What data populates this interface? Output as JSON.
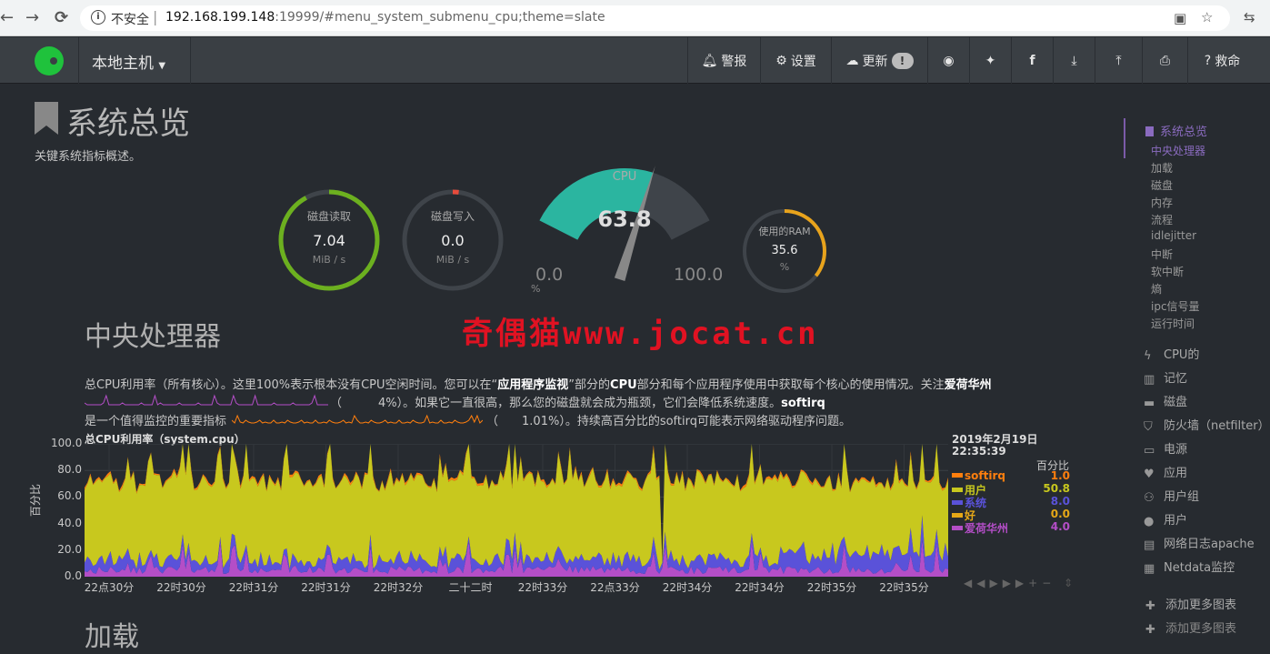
{
  "browser": {
    "insecure_label": "不安全",
    "url_host": "192.168.199.148",
    "url_rest": ":19999/#menu_system_submenu_cpu;theme=slate",
    "back": "←",
    "forward": "→",
    "reload": "⟳"
  },
  "topbar": {
    "host_label": "本地主机",
    "alarms": "警报",
    "settings": "设置",
    "update": "更新",
    "update_badge": "!",
    "help": "救命"
  },
  "page": {
    "title": "系统总览",
    "subtitle": "关键系统指标概述。",
    "section_cpu": "中央处理器",
    "section_load": "加载",
    "watermark": "奇偶猫www.jocat.cn"
  },
  "gauges": {
    "disk_read": {
      "label": "磁盘读取",
      "value": "7.04",
      "unit": "MiB / s",
      "fraction": 0.92
    },
    "disk_write": {
      "label": "磁盘写入",
      "value": "0.0",
      "unit": "MiB / s",
      "fraction": 0.01
    },
    "cpu": {
      "label": "CPU",
      "value": "63.8",
      "min": "0.0",
      "max": "100.0",
      "unit": "%",
      "fraction": 0.638
    },
    "ram": {
      "label": "使用的RAM",
      "value": "35.6",
      "unit": "%",
      "fraction": 0.356
    }
  },
  "description": {
    "line1_a": "总CPU利用率（所有核心）。这里100%表示根本没有CPU空闲时间。您可以在“",
    "line1_b": "应用程序监视",
    "line1_c": "”部分的",
    "line1_d": "CPU",
    "line1_e": "部分和每个应用程序使用中获取每个核心的使用情况。关注",
    "line1_f": "爱荷华州",
    "line2_a": "（",
    "line2_b": "4%）。如果它一直很高，那么您的磁盘就会成为瓶颈，它们会降低系统速度。",
    "line2_c": "softirq",
    "line3_a": "是一个值得监控的重要指标",
    "line3_b": "（",
    "line3_c": "1.01%）。持续高百分比的softirq可能表示网络驱动程序问题。"
  },
  "chart_data": {
    "type": "area",
    "title": "总CPU利用率（system.cpu）",
    "ylabel": "百分比",
    "ylim": [
      0,
      100
    ],
    "yticks": [
      "100.0",
      "80.0",
      "60.0",
      "40.0",
      "20.0",
      "0.0"
    ],
    "xticks": [
      "22点30分",
      "22时30分",
      "22时31分",
      "22时31分",
      "22时32分",
      "二十二时",
      "22时33分",
      "22点33分",
      "22时34分",
      "22时34分",
      "22时35分",
      "22时35分"
    ],
    "stacked": true,
    "series": [
      {
        "name": "softirq",
        "color": "#ff7f0e",
        "value": "1.0"
      },
      {
        "name": "用户",
        "color": "#c8c81e",
        "value": "50.8"
      },
      {
        "name": "系统",
        "color": "#5a52d9",
        "value": "8.0"
      },
      {
        "name": "好",
        "color": "#e6a817",
        "value": "0.0"
      },
      {
        "name": "爱荷华州",
        "color": "#b44ec7",
        "value": "4.0"
      }
    ],
    "legend_date": "2019年2月19日",
    "legend_time": "22:35:39",
    "legend_unit": "百分比",
    "legend_position": "right"
  },
  "sidebar": {
    "active_section": "系统总览",
    "subitems": [
      "中央处理器",
      "加载",
      "磁盘",
      "内存",
      "流程",
      "idlejitter",
      "中断",
      "软中断",
      "熵",
      "ipc信号量",
      "运行时间"
    ],
    "menus": [
      {
        "label": "CPU的",
        "icon": "bolt-icon"
      },
      {
        "label": "记忆",
        "icon": "memory-icon"
      },
      {
        "label": "磁盘",
        "icon": "hdd-icon"
      },
      {
        "label": "防火墙（netfilter）",
        "icon": "shield-icon"
      },
      {
        "label": "电源",
        "icon": "battery-icon"
      },
      {
        "label": "应用",
        "icon": "heartbeat-icon"
      },
      {
        "label": "用户组",
        "icon": "users-icon"
      },
      {
        "label": "用户",
        "icon": "user-icon"
      },
      {
        "label": "网络日志apache",
        "icon": "file-icon"
      },
      {
        "label": "Netdata监控",
        "icon": "chart-icon"
      }
    ],
    "add_more": "添加更多图表",
    "add_more_2": "添加更多图表"
  },
  "colors": {
    "accent": "#7b5ba8",
    "disk_read": "#6cb01f",
    "disk_write": "#e74c3c",
    "cpu": "#2bb5a0",
    "ram": "#e8a31c"
  }
}
